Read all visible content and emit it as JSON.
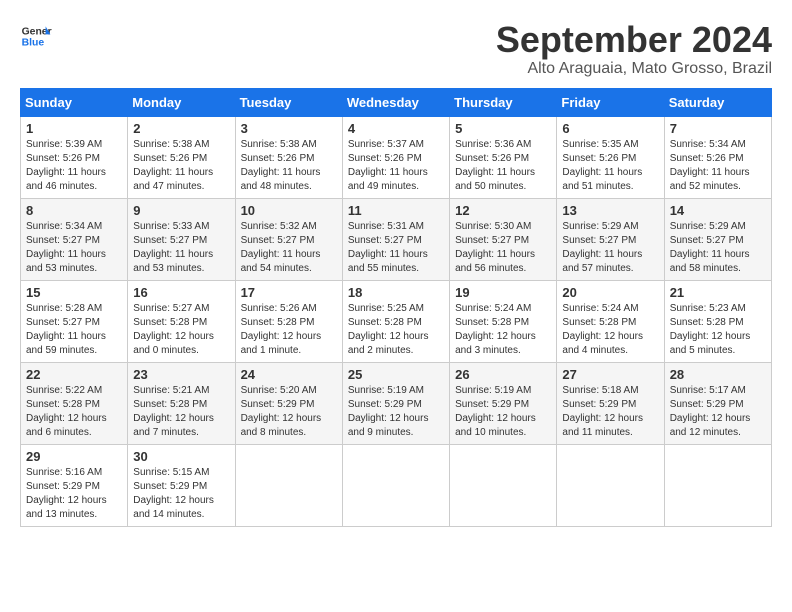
{
  "header": {
    "logo_line1": "General",
    "logo_line2": "Blue",
    "month": "September 2024",
    "location": "Alto Araguaia, Mato Grosso, Brazil"
  },
  "days_of_week": [
    "Sunday",
    "Monday",
    "Tuesday",
    "Wednesday",
    "Thursday",
    "Friday",
    "Saturday"
  ],
  "weeks": [
    [
      {
        "day": "1",
        "sunrise": "5:39 AM",
        "sunset": "5:26 PM",
        "daylight": "11 hours and 46 minutes."
      },
      {
        "day": "2",
        "sunrise": "5:38 AM",
        "sunset": "5:26 PM",
        "daylight": "11 hours and 47 minutes."
      },
      {
        "day": "3",
        "sunrise": "5:38 AM",
        "sunset": "5:26 PM",
        "daylight": "11 hours and 48 minutes."
      },
      {
        "day": "4",
        "sunrise": "5:37 AM",
        "sunset": "5:26 PM",
        "daylight": "11 hours and 49 minutes."
      },
      {
        "day": "5",
        "sunrise": "5:36 AM",
        "sunset": "5:26 PM",
        "daylight": "11 hours and 50 minutes."
      },
      {
        "day": "6",
        "sunrise": "5:35 AM",
        "sunset": "5:26 PM",
        "daylight": "11 hours and 51 minutes."
      },
      {
        "day": "7",
        "sunrise": "5:34 AM",
        "sunset": "5:26 PM",
        "daylight": "11 hours and 52 minutes."
      }
    ],
    [
      {
        "day": "8",
        "sunrise": "5:34 AM",
        "sunset": "5:27 PM",
        "daylight": "11 hours and 53 minutes."
      },
      {
        "day": "9",
        "sunrise": "5:33 AM",
        "sunset": "5:27 PM",
        "daylight": "11 hours and 53 minutes."
      },
      {
        "day": "10",
        "sunrise": "5:32 AM",
        "sunset": "5:27 PM",
        "daylight": "11 hours and 54 minutes."
      },
      {
        "day": "11",
        "sunrise": "5:31 AM",
        "sunset": "5:27 PM",
        "daylight": "11 hours and 55 minutes."
      },
      {
        "day": "12",
        "sunrise": "5:30 AM",
        "sunset": "5:27 PM",
        "daylight": "11 hours and 56 minutes."
      },
      {
        "day": "13",
        "sunrise": "5:29 AM",
        "sunset": "5:27 PM",
        "daylight": "11 hours and 57 minutes."
      },
      {
        "day": "14",
        "sunrise": "5:29 AM",
        "sunset": "5:27 PM",
        "daylight": "11 hours and 58 minutes."
      }
    ],
    [
      {
        "day": "15",
        "sunrise": "5:28 AM",
        "sunset": "5:27 PM",
        "daylight": "11 hours and 59 minutes."
      },
      {
        "day": "16",
        "sunrise": "5:27 AM",
        "sunset": "5:28 PM",
        "daylight": "12 hours and 0 minutes."
      },
      {
        "day": "17",
        "sunrise": "5:26 AM",
        "sunset": "5:28 PM",
        "daylight": "12 hours and 1 minute."
      },
      {
        "day": "18",
        "sunrise": "5:25 AM",
        "sunset": "5:28 PM",
        "daylight": "12 hours and 2 minutes."
      },
      {
        "day": "19",
        "sunrise": "5:24 AM",
        "sunset": "5:28 PM",
        "daylight": "12 hours and 3 minutes."
      },
      {
        "day": "20",
        "sunrise": "5:24 AM",
        "sunset": "5:28 PM",
        "daylight": "12 hours and 4 minutes."
      },
      {
        "day": "21",
        "sunrise": "5:23 AM",
        "sunset": "5:28 PM",
        "daylight": "12 hours and 5 minutes."
      }
    ],
    [
      {
        "day": "22",
        "sunrise": "5:22 AM",
        "sunset": "5:28 PM",
        "daylight": "12 hours and 6 minutes."
      },
      {
        "day": "23",
        "sunrise": "5:21 AM",
        "sunset": "5:28 PM",
        "daylight": "12 hours and 7 minutes."
      },
      {
        "day": "24",
        "sunrise": "5:20 AM",
        "sunset": "5:29 PM",
        "daylight": "12 hours and 8 minutes."
      },
      {
        "day": "25",
        "sunrise": "5:19 AM",
        "sunset": "5:29 PM",
        "daylight": "12 hours and 9 minutes."
      },
      {
        "day": "26",
        "sunrise": "5:19 AM",
        "sunset": "5:29 PM",
        "daylight": "12 hours and 10 minutes."
      },
      {
        "day": "27",
        "sunrise": "5:18 AM",
        "sunset": "5:29 PM",
        "daylight": "12 hours and 11 minutes."
      },
      {
        "day": "28",
        "sunrise": "5:17 AM",
        "sunset": "5:29 PM",
        "daylight": "12 hours and 12 minutes."
      }
    ],
    [
      {
        "day": "29",
        "sunrise": "5:16 AM",
        "sunset": "5:29 PM",
        "daylight": "12 hours and 13 minutes."
      },
      {
        "day": "30",
        "sunrise": "5:15 AM",
        "sunset": "5:29 PM",
        "daylight": "12 hours and 14 minutes."
      },
      null,
      null,
      null,
      null,
      null
    ]
  ]
}
